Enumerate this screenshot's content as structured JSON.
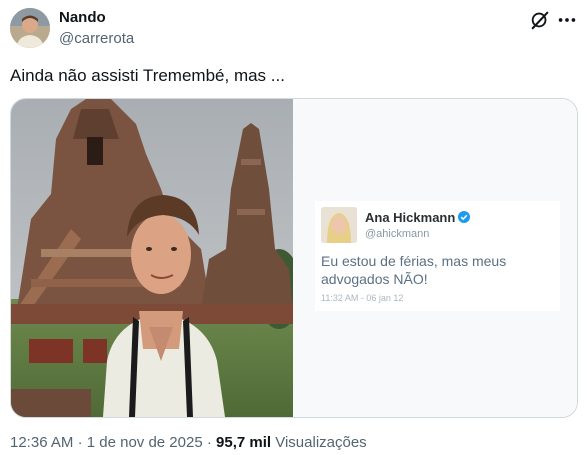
{
  "tweet": {
    "author_name": "Nando",
    "author_handle": "@carrerota",
    "text": "Ainda não assisti Tremembé, mas ...",
    "time": "12:36 AM",
    "date": "1 de nov de 2025",
    "views_count": "95,7 mil",
    "views_label": "Visualizações",
    "separator": "·"
  },
  "quoted_tweet": {
    "name": "Ana Hickmann",
    "handle": "@ahickmann",
    "text": "Eu estou de férias, mas meus advogados NÃO!",
    "timestamp": "11:32 AM - 06 jan 12"
  },
  "icons": {
    "grok": "grok-icon",
    "more": "more-icon",
    "verified": "verified-badge-icon"
  },
  "colors": {
    "text_primary": "#0f1419",
    "text_secondary": "#536471",
    "border": "#cfd9de",
    "verified_blue": "#1d9bf0"
  }
}
